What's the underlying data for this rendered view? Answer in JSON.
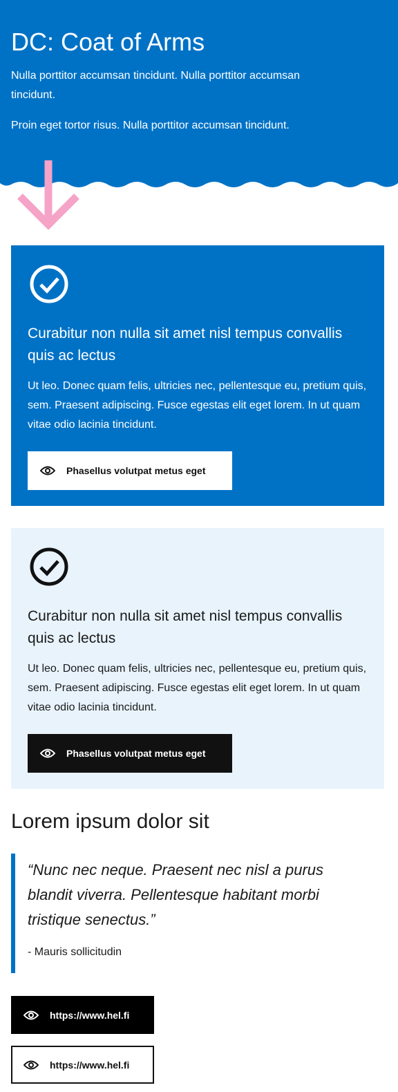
{
  "hero": {
    "title": "DC: Coat of Arms",
    "paragraphs": [
      "Nulla porttitor accumsan tincidunt. Nulla porttitor accumsan tincidunt.",
      "Proin eget tortor risus. Nulla porttitor accumsan tincidunt."
    ]
  },
  "colors": {
    "brand": "#0072c6",
    "accent_arrow": "#f5a3c7",
    "light_card": "#e8f3fc"
  },
  "cards": [
    {
      "icon": "check-circle-icon",
      "heading": "Curabitur non nulla sit amet nisl tempus convallis quis ac lectus",
      "body": "Ut leo. Donec quam felis, ultricies nec, pellentesque eu, pretium quis, sem. Praesent adipiscing. Fusce egestas elit eget lorem. In ut quam vitae odio lacinia tincidunt.",
      "button": "Phasellus volutpat metus eget"
    },
    {
      "icon": "check-circle-icon",
      "heading": "Curabitur non nulla sit amet nisl tempus convallis quis ac lectus",
      "body": "Ut leo. Donec quam felis, ultricies nec, pellentesque eu, pretium quis, sem. Praesent adipiscing. Fusce egestas elit eget lorem. In ut quam vitae odio lacinia tincidunt.",
      "button": "Phasellus volutpat metus eget"
    }
  ],
  "section": {
    "heading": "Lorem ipsum dolor sit",
    "quote": "“Nunc nec neque. Praesent nec nisl a purus blandit viverra. Pellentesque habitant morbi tristique senectus.”",
    "cite": "- Mauris sollicitudin"
  },
  "links": [
    "https://www.hel.fi",
    "https://www.hel.fi"
  ]
}
